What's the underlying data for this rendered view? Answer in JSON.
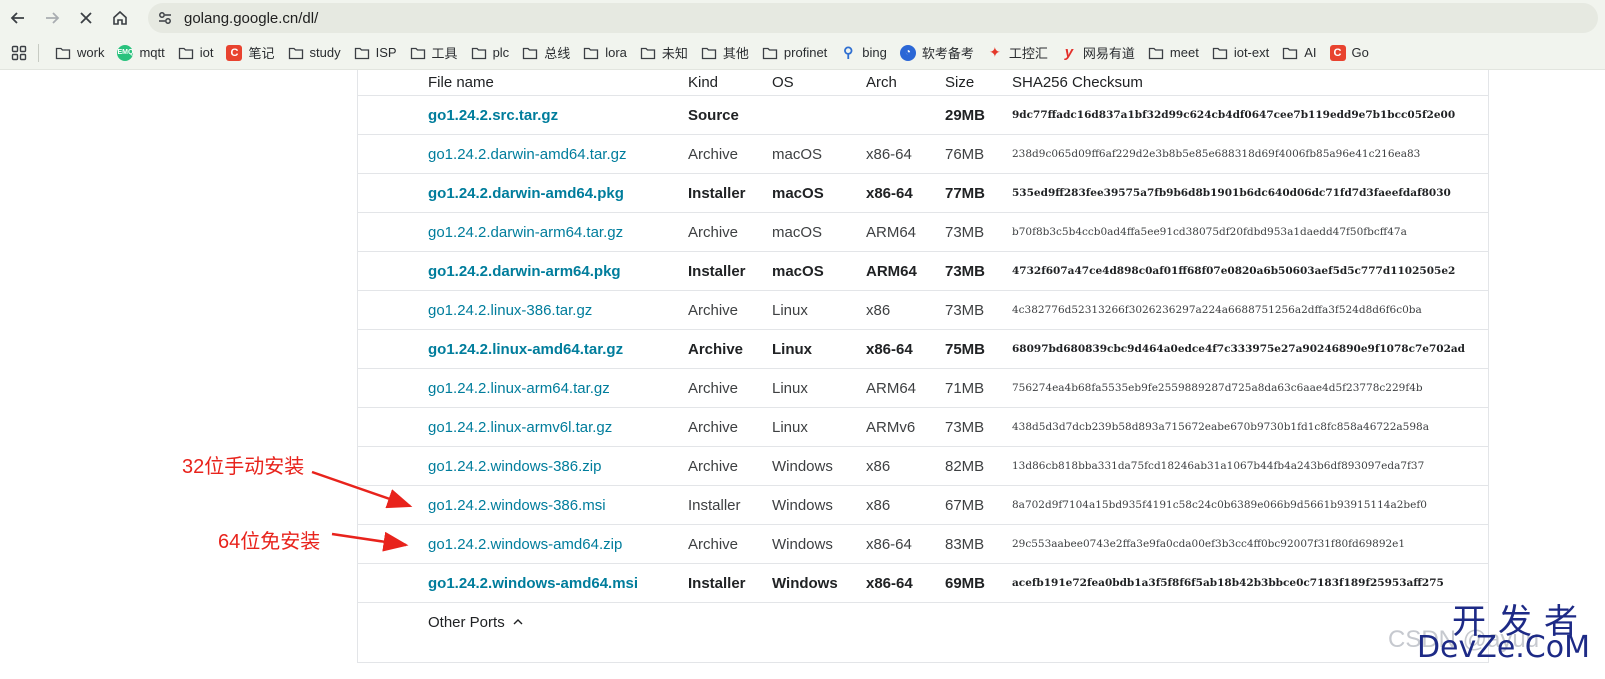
{
  "browser": {
    "url": "golang.google.cn/dl/"
  },
  "bookmarks": [
    {
      "label": "work",
      "icon": "folder-icon",
      "type": "folder"
    },
    {
      "label": "mqtt",
      "icon": "emqx-favicon",
      "type": "emqx"
    },
    {
      "label": "iot",
      "icon": "folder-icon",
      "type": "folder"
    },
    {
      "label": "笔记",
      "icon": "csdn-favicon",
      "type": "csdn"
    },
    {
      "label": "study",
      "icon": "folder-icon",
      "type": "folder"
    },
    {
      "label": "ISP",
      "icon": "folder-icon",
      "type": "folder"
    },
    {
      "label": "工具",
      "icon": "folder-icon",
      "type": "folder"
    },
    {
      "label": "plc",
      "icon": "folder-icon",
      "type": "folder"
    },
    {
      "label": "总线",
      "icon": "folder-icon",
      "type": "folder"
    },
    {
      "label": "lora",
      "icon": "folder-icon",
      "type": "folder"
    },
    {
      "label": "未知",
      "icon": "folder-icon",
      "type": "folder"
    },
    {
      "label": "其他",
      "icon": "folder-icon",
      "type": "folder"
    },
    {
      "label": "profinet",
      "icon": "folder-icon",
      "type": "folder"
    },
    {
      "label": "bing",
      "icon": "bing-search-icon",
      "type": "bing"
    },
    {
      "label": "软考备考",
      "icon": "ruankao-favicon",
      "type": "ruankao"
    },
    {
      "label": "工控汇",
      "icon": "gongkong-favicon",
      "type": "gongkong"
    },
    {
      "label": "网易有道",
      "icon": "youdao-favicon",
      "type": "youdao"
    },
    {
      "label": "meet",
      "icon": "folder-icon",
      "type": "folder"
    },
    {
      "label": "iot-ext",
      "icon": "folder-icon",
      "type": "folder"
    },
    {
      "label": "AI",
      "icon": "folder-icon",
      "type": "folder"
    },
    {
      "label": "Go",
      "icon": "csdn-favicon",
      "type": "csdn"
    }
  ],
  "table": {
    "headers": {
      "file": "File name",
      "kind": "Kind",
      "os": "OS",
      "arch": "Arch",
      "size": "Size",
      "sha": "SHA256 Checksum"
    },
    "rows": [
      {
        "file": "go1.24.2.src.tar.gz",
        "kind": "Source",
        "os": "",
        "arch": "",
        "size": "29MB",
        "sha": "9dc77ffadc16d837a1bf32d99c624cb4df0647cee7b119edd9e7b1bcc05f2e00",
        "highlight": true
      },
      {
        "file": "go1.24.2.darwin-amd64.tar.gz",
        "kind": "Archive",
        "os": "macOS",
        "arch": "x86-64",
        "size": "76MB",
        "sha": "238d9c065d09ff6af229d2e3b8b5e85e688318d69f4006fb85a96e41c216ea83",
        "highlight": false
      },
      {
        "file": "go1.24.2.darwin-amd64.pkg",
        "kind": "Installer",
        "os": "macOS",
        "arch": "x86-64",
        "size": "77MB",
        "sha": "535ed9ff283fee39575a7fb9b6d8b1901b6dc640d06dc71fd7d3faeefdaf8030",
        "highlight": true
      },
      {
        "file": "go1.24.2.darwin-arm64.tar.gz",
        "kind": "Archive",
        "os": "macOS",
        "arch": "ARM64",
        "size": "73MB",
        "sha": "b70f8b3c5b4ccb0ad4ffa5ee91cd38075df20fdbd953a1daedd47f50fbcff47a",
        "highlight": false
      },
      {
        "file": "go1.24.2.darwin-arm64.pkg",
        "kind": "Installer",
        "os": "macOS",
        "arch": "ARM64",
        "size": "73MB",
        "sha": "4732f607a47ce4d898c0af01ff68f07e0820a6b50603aef5d5c777d1102505e2",
        "highlight": true
      },
      {
        "file": "go1.24.2.linux-386.tar.gz",
        "kind": "Archive",
        "os": "Linux",
        "arch": "x86",
        "size": "73MB",
        "sha": "4c382776d52313266f3026236297a224a6688751256a2dffa3f524d8d6f6c0ba",
        "highlight": false
      },
      {
        "file": "go1.24.2.linux-amd64.tar.gz",
        "kind": "Archive",
        "os": "Linux",
        "arch": "x86-64",
        "size": "75MB",
        "sha": "68097bd680839cbc9d464a0edce4f7c333975e27a90246890e9f1078c7e702ad",
        "highlight": true
      },
      {
        "file": "go1.24.2.linux-arm64.tar.gz",
        "kind": "Archive",
        "os": "Linux",
        "arch": "ARM64",
        "size": "71MB",
        "sha": "756274ea4b68fa5535eb9fe2559889287d725a8da63c6aae4d5f23778c229f4b",
        "highlight": false
      },
      {
        "file": "go1.24.2.linux-armv6l.tar.gz",
        "kind": "Archive",
        "os": "Linux",
        "arch": "ARMv6",
        "size": "73MB",
        "sha": "438d5d3d7dcb239b58d893a715672eabe670b9730b1fd1c8fc858a46722a598a",
        "highlight": false
      },
      {
        "file": "go1.24.2.windows-386.zip",
        "kind": "Archive",
        "os": "Windows",
        "arch": "x86",
        "size": "82MB",
        "sha": "13d86cb818bba331da75fcd18246ab31a1067b44fb4a243b6df893097eda7f37",
        "highlight": false
      },
      {
        "file": "go1.24.2.windows-386.msi",
        "kind": "Installer",
        "os": "Windows",
        "arch": "x86",
        "size": "67MB",
        "sha": "8a702d9f7104a15bd935f4191c58c24c0b6389e066b9d5661b93915114a2bef0",
        "highlight": false
      },
      {
        "file": "go1.24.2.windows-amd64.zip",
        "kind": "Archive",
        "os": "Windows",
        "arch": "x86-64",
        "size": "83MB",
        "sha": "29c553aabee0743e2ffa3e9fa0cda00ef3b3cc4ff0bc92007f31f80fd69892e1",
        "highlight": false
      },
      {
        "file": "go1.24.2.windows-amd64.msi",
        "kind": "Installer",
        "os": "Windows",
        "arch": "x86-64",
        "size": "69MB",
        "sha": "acefb191e72fea0bdb1a3f5f8f6f5ab18b42b3bbce0c7183f189f25953aff275",
        "highlight": true
      }
    ],
    "other_ports": "Other Ports"
  },
  "annotations": {
    "label_32": "32位手动安装",
    "label_64": "64位免安装",
    "color": "#e8231c"
  },
  "watermark": {
    "cn": "开发者",
    "en": "DevZe.CoM",
    "csdn": "CSDN @ayuu"
  },
  "colors": {
    "link": "#007d9c",
    "chrome": "#f1f4ee"
  }
}
